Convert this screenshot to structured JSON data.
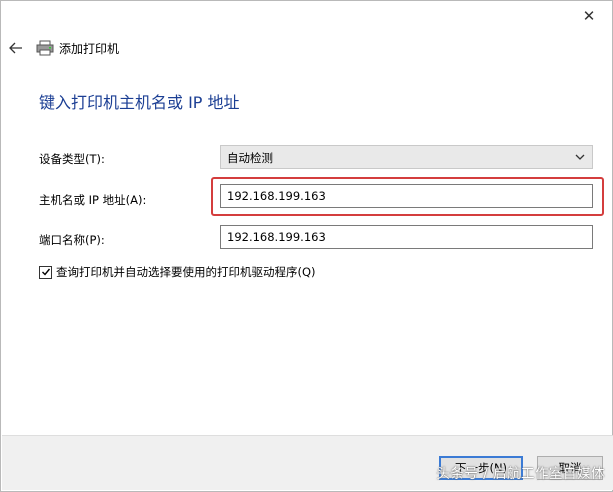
{
  "window": {
    "close_glyph": "✕",
    "title": "添加打印机"
  },
  "page": {
    "heading": "键入打印机主机名或 IP 地址"
  },
  "form": {
    "device_type_label": "设备类型(T):",
    "device_type_value": "自动检测",
    "hostname_label": "主机名或 IP 地址(A):",
    "hostname_value": "192.168.199.163",
    "port_label": "端口名称(P):",
    "port_value": "192.168.199.163",
    "query_checkbox_label": "查询打印机并自动选择要使用的打印机驱动程序(Q)",
    "query_checkbox_checked": true
  },
  "footer": {
    "next_button": "下一步(N)",
    "cancel_button": "取消"
  },
  "watermark": "头条号 / 启航工作室自媒体",
  "colors": {
    "heading": "#1c3f94",
    "highlight": "#d43d3d",
    "primary_border": "#3b7bd5"
  }
}
